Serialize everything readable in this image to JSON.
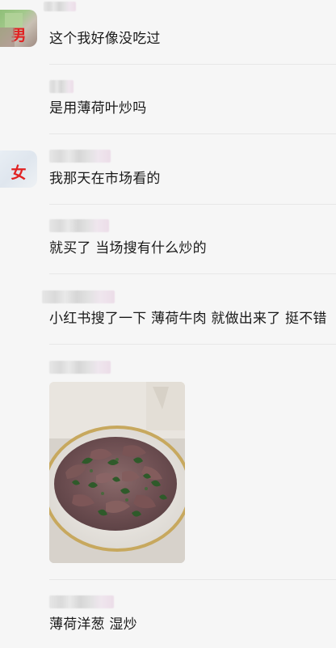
{
  "comments": [
    {
      "gender_label": "男",
      "text": "这个我好像没吃过"
    },
    {
      "text": "是用薄荷叶炒吗"
    },
    {
      "gender_label": "女",
      "text": "我那天在市场看的"
    },
    {
      "text": "就买了 当场搜有什么炒的"
    },
    {
      "text": "小红书搜了一下 薄荷牛肉 就做出来了 挺不错"
    },
    {
      "image": "stir-fried-mint-beef-photo"
    },
    {
      "text": "薄荷洋葱 湿炒"
    }
  ],
  "colors": {
    "background": "#f6f6f6",
    "text": "#1a1a1a",
    "gender_badge": "#e12222",
    "divider": "#e7e7e7"
  }
}
